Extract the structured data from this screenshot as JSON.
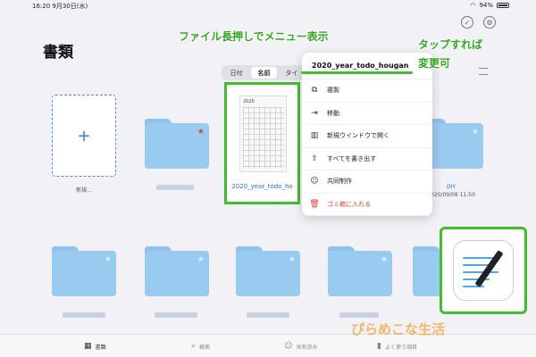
{
  "status": {
    "time": "16:20",
    "date": "9月30日(水)",
    "battery": "94%"
  },
  "page_title": "書類",
  "sort": {
    "options": [
      "日付",
      "名前",
      "タイ"
    ],
    "selected": "名前"
  },
  "new_tile": {
    "label": "新規..."
  },
  "document": {
    "name": "2020_year_todo_ho",
    "thumb_year": "2020"
  },
  "folders": {
    "diy_label": "DIY",
    "diy_date": "2020/09/08 11:50"
  },
  "menu": {
    "header": "2020_year_todo_hougan",
    "items": [
      {
        "label": "複製",
        "icon": "duplicate-icon"
      },
      {
        "label": "移動",
        "icon": "move-icon"
      },
      {
        "label": "新規ウインドウで開く",
        "icon": "new-window-icon"
      },
      {
        "label": "すべてを書き出す",
        "icon": "export-icon"
      },
      {
        "label": "共同制作",
        "icon": "collaborate-icon"
      },
      {
        "label": "ゴミ箱に入れる",
        "icon": "trash-icon"
      }
    ]
  },
  "annotations": {
    "long_press": "ファイル長押しでメニュー表示",
    "tap_line1": "タップすれば",
    "tap_line2": "変更可"
  },
  "tabbar": {
    "docs": "書類",
    "search": "検索",
    "shared": "共有済み",
    "recent": "よく使う項目"
  },
  "watermark": "ぴらめこな生活",
  "colors": {
    "accent": "#2f7bf5",
    "annotation": "#3fbf2b",
    "folder": "#99cbf1",
    "danger": "#e03b30"
  }
}
